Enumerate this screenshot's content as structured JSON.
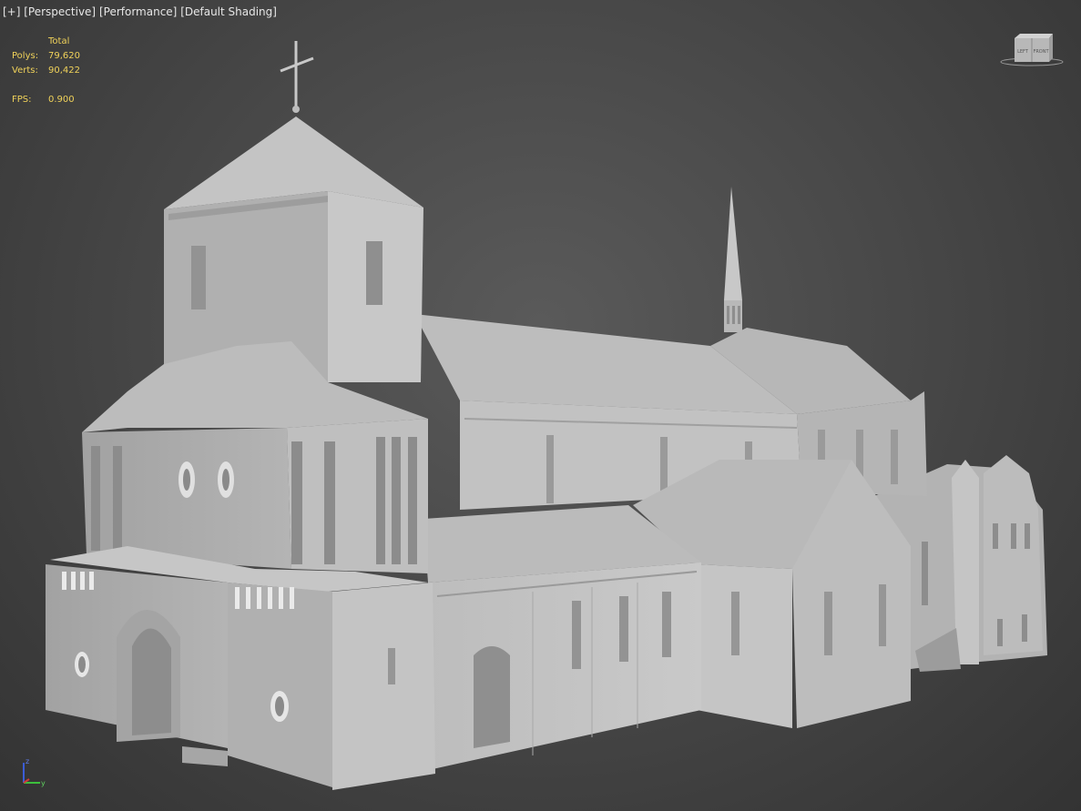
{
  "viewport": {
    "labels": {
      "plus": "[+]",
      "view": "[Perspective]",
      "mode": "[Performance]",
      "shading": "[Default Shading]"
    },
    "stats": {
      "header": "Total",
      "polys_label": "Polys:",
      "polys_value": "79,620",
      "verts_label": "Verts:",
      "verts_value": "90,422",
      "fps_label": "FPS:",
      "fps_value": "0.900"
    },
    "viewcube": {
      "left": "LEFT",
      "front": "FRONT"
    },
    "axis": {
      "z": "z",
      "y": "y"
    }
  }
}
